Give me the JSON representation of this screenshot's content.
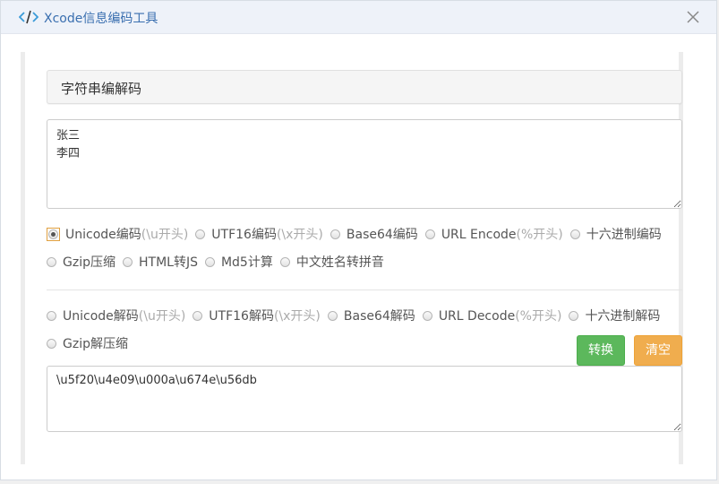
{
  "window": {
    "title": "Xcode信息编码工具",
    "app_icon": "code-icon",
    "close_icon": "close-icon"
  },
  "section": {
    "title": "字符串编解码"
  },
  "input": {
    "value": "张三\n李四"
  },
  "encode_options": [
    {
      "label": "Unicode编码",
      "hint": "(\\u开头)",
      "checked": true
    },
    {
      "label": "UTF16编码",
      "hint": "(\\x开头)",
      "checked": false
    },
    {
      "label": "Base64编码",
      "hint": "",
      "checked": false
    },
    {
      "label": "URL Encode",
      "hint": "(%开头)",
      "checked": false
    },
    {
      "label": "十六进制编码",
      "hint": "",
      "checked": false
    },
    {
      "label": "Gzip压缩",
      "hint": "",
      "checked": false
    },
    {
      "label": "HTML转JS",
      "hint": "",
      "checked": false
    },
    {
      "label": "Md5计算",
      "hint": "",
      "checked": false
    },
    {
      "label": "中文姓名转拼音",
      "hint": "",
      "checked": false
    }
  ],
  "decode_options": [
    {
      "label": "Unicode解码",
      "hint": "(\\u开头)",
      "checked": false
    },
    {
      "label": "UTF16解码",
      "hint": "(\\x开头)",
      "checked": false
    },
    {
      "label": "Base64解码",
      "hint": "",
      "checked": false
    },
    {
      "label": "URL Decode",
      "hint": "(%开头)",
      "checked": false
    },
    {
      "label": "十六进制解码",
      "hint": "",
      "checked": false
    },
    {
      "label": "Gzip解压缩",
      "hint": "",
      "checked": false
    }
  ],
  "buttons": {
    "convert": "转换",
    "clear": "清空"
  },
  "output": {
    "value": "\\u5f20\\u4e09\\u000a\\u674e\\u56db"
  },
  "colors": {
    "title": "#3a6fb0",
    "convert": "#5cb85c",
    "clear": "#f0ad4e"
  }
}
